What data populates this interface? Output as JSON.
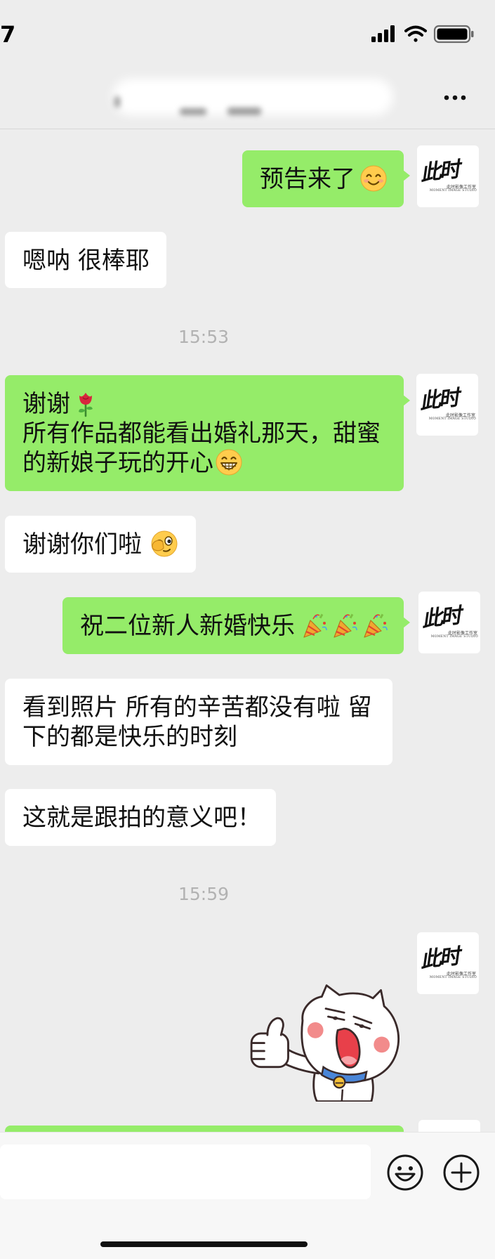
{
  "status_bar": {
    "time": "7",
    "icons": [
      "cellular-signal-icon",
      "wifi-icon",
      "battery-icon"
    ]
  },
  "header": {
    "more_icon": "more-dots-icon"
  },
  "colors": {
    "background": "#ededed",
    "sent_bubble": "#95ec69",
    "received_bubble": "#ffffff",
    "timestamp": "#b2b2b2",
    "text": "#111111"
  },
  "avatar_logo": {
    "text": "此时",
    "subtitle_cn": "此时影像工作室",
    "subtitle_en": "MOMENT IMAGE STUDIO"
  },
  "chat": [
    {
      "type": "message",
      "side": "sent",
      "lines": [
        {
          "text": "预告来了",
          "emojis": [
            "smiling-face"
          ]
        }
      ]
    },
    {
      "type": "message",
      "side": "received",
      "lines": [
        {
          "text": "嗯呐 很棒耶"
        }
      ]
    },
    {
      "type": "time",
      "text": "15:53"
    },
    {
      "type": "message",
      "side": "sent",
      "lines": [
        {
          "text": "谢谢",
          "emojis": [
            "rose"
          ]
        },
        {
          "text": "所有作品都能看出婚礼那天，甜蜜"
        },
        {
          "text": "的新娘子玩的开心",
          "emojis": [
            "grinning-face"
          ]
        }
      ]
    },
    {
      "type": "message",
      "side": "received",
      "lines": [
        {
          "text": "谢谢你们啦",
          "emojis": [
            "wink-face"
          ]
        }
      ]
    },
    {
      "type": "message",
      "side": "sent",
      "lines": [
        {
          "text": "祝二位新人新婚快乐",
          "emojis": [
            "party-popper",
            "party-popper",
            "party-popper"
          ]
        }
      ]
    },
    {
      "type": "message",
      "side": "received",
      "lines": [
        {
          "text": "看到照片 所有的辛苦都没有啦 留"
        },
        {
          "text": "下的都是快乐的时刻"
        }
      ]
    },
    {
      "type": "message",
      "side": "received",
      "lines": [
        {
          "text": "这就是跟拍的意义吧！"
        }
      ]
    },
    {
      "type": "time",
      "text": "15:59"
    },
    {
      "type": "sticker",
      "side": "sent",
      "sticker": "white-cat-thumbs-up"
    },
    {
      "type": "message",
      "side": "sent",
      "lines": []
    }
  ],
  "input_bar": {
    "emoji_icon": "emoji-face-icon",
    "more_icon": "plus-circle-icon"
  }
}
